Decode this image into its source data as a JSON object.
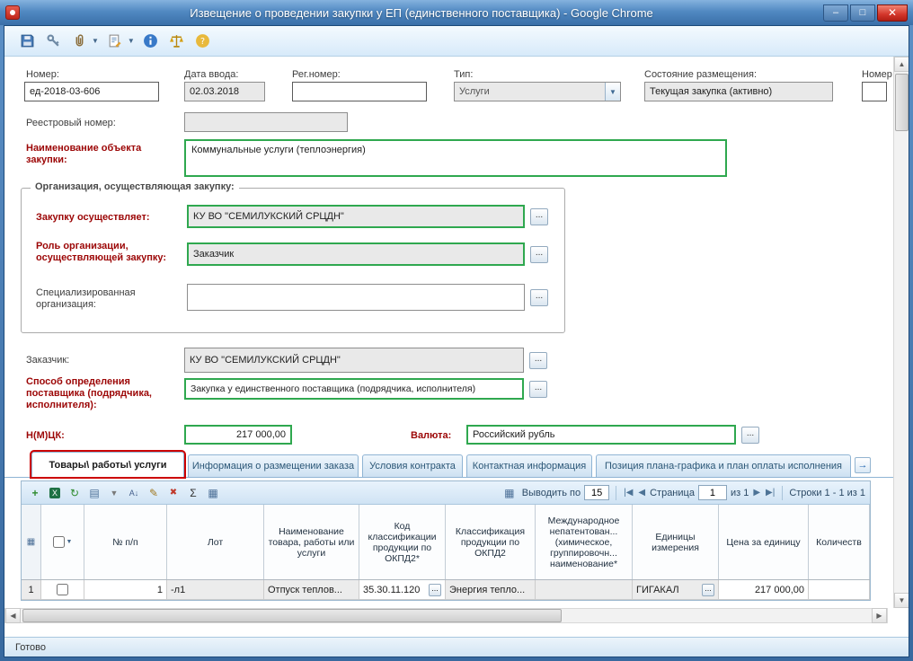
{
  "window": {
    "title": "Извещение о проведении закупки у ЕП (единственного поставщика) - Google Chrome"
  },
  "titlebar_controls": {
    "minimize": "–",
    "maximize": "□",
    "close": "✕"
  },
  "icons": {
    "app_toolbar": [
      "save-icon",
      "signature-icon",
      "attachment-icon",
      "report-icon",
      "info-icon",
      "scales-icon",
      "help-icon"
    ],
    "grid_toolbar": [
      "add-row-icon",
      "export-excel-icon",
      "refresh-icon",
      "list-icon",
      "filter-icon",
      "sort-icon",
      "edit-filter-icon",
      "clear-filter-icon",
      "sum-icon",
      "columns-icon"
    ],
    "pager": [
      "first-page-icon",
      "prev-page-icon",
      "next-page-icon",
      "last-page-icon"
    ]
  },
  "colors": {
    "required_label": "#9c0606",
    "required_border": "#2fa84f",
    "tab_highlight": "#cc0000",
    "readonly_bg": "#e9e9e9"
  },
  "form": {
    "number": {
      "label": "Номер:",
      "value": "ед-2018-03-606"
    },
    "entry_date": {
      "label": "Дата ввода:",
      "value": "02.03.2018"
    },
    "reg_number": {
      "label": "Рег.номер:",
      "value": ""
    },
    "type": {
      "label": "Тип:",
      "value": "Услуги"
    },
    "placement_state": {
      "label": "Состояние размещения:",
      "value": "Текущая закупка (активно)"
    },
    "number_partial": {
      "label": "Номер",
      "value": ""
    },
    "registry_number": {
      "label": "Реестровый номер:",
      "value": ""
    },
    "object_name": {
      "label": "Наименование объекта закупки:",
      "value": "Коммунальные услуги (теплоэнергия)"
    },
    "org_group": {
      "legend": "Организация, осуществляющая закупку:",
      "purchaser": {
        "label": "Закупку осуществляет:",
        "value": "КУ ВО \"СЕМИЛУКСКИЙ СРЦДН\""
      },
      "role": {
        "label": "Роль организации, осуществляющей закупку:",
        "value": "Заказчик"
      },
      "specialized": {
        "label": "Специализированная организация:",
        "value": ""
      }
    },
    "customer": {
      "label": "Заказчик:",
      "value": "КУ ВО \"СЕМИЛУКСКИЙ СРЦДН\""
    },
    "method": {
      "label": "Способ определения поставщика (подрядчика, исполнителя):",
      "value": "Закупка у единственного поставщика (подрядчика, исполнителя)"
    },
    "nmck": {
      "label": "Н(М)ЦК:",
      "value": "217 000,00"
    },
    "currency": {
      "label": "Валюта:",
      "value": "Российский рубль"
    },
    "ellipsis": "..."
  },
  "tabs": [
    {
      "label": "Товары\\ работы\\ услуги",
      "active": true
    },
    {
      "label": "Информация о размещении заказа"
    },
    {
      "label": "Условия контракта"
    },
    {
      "label": "Контактная информация"
    },
    {
      "label": "Позиция плана-графика и план оплаты исполнения"
    }
  ],
  "grid": {
    "pager": {
      "page_size_label": "Выводить по",
      "page_size": "15",
      "page_label": "Страница",
      "page": "1",
      "of": "из 1",
      "rows_info": "Строки 1 - 1 из 1"
    },
    "columns": [
      "№ п/п",
      "Лот",
      "Наименование товара, работы или услуги",
      "Код классификации продукции по ОКПД2*",
      "Классификация продукции по ОКПД2",
      "Международное непатентован... (химическое, группировочн... наименование*",
      "Единицы измерения",
      "Цена за единицу",
      "Количеств"
    ],
    "row": {
      "num": "1",
      "npp": "1",
      "lot": "-л1",
      "name": "Отпуск теплов...",
      "okpd2_code": "35.30.11.120",
      "okpd2_class": "Энергия тепло...",
      "mnn": "",
      "unit": "ГИГАКАЛ",
      "unit_price": "217 000,00",
      "quantity": ""
    }
  },
  "statusbar": {
    "text": "Готово"
  }
}
